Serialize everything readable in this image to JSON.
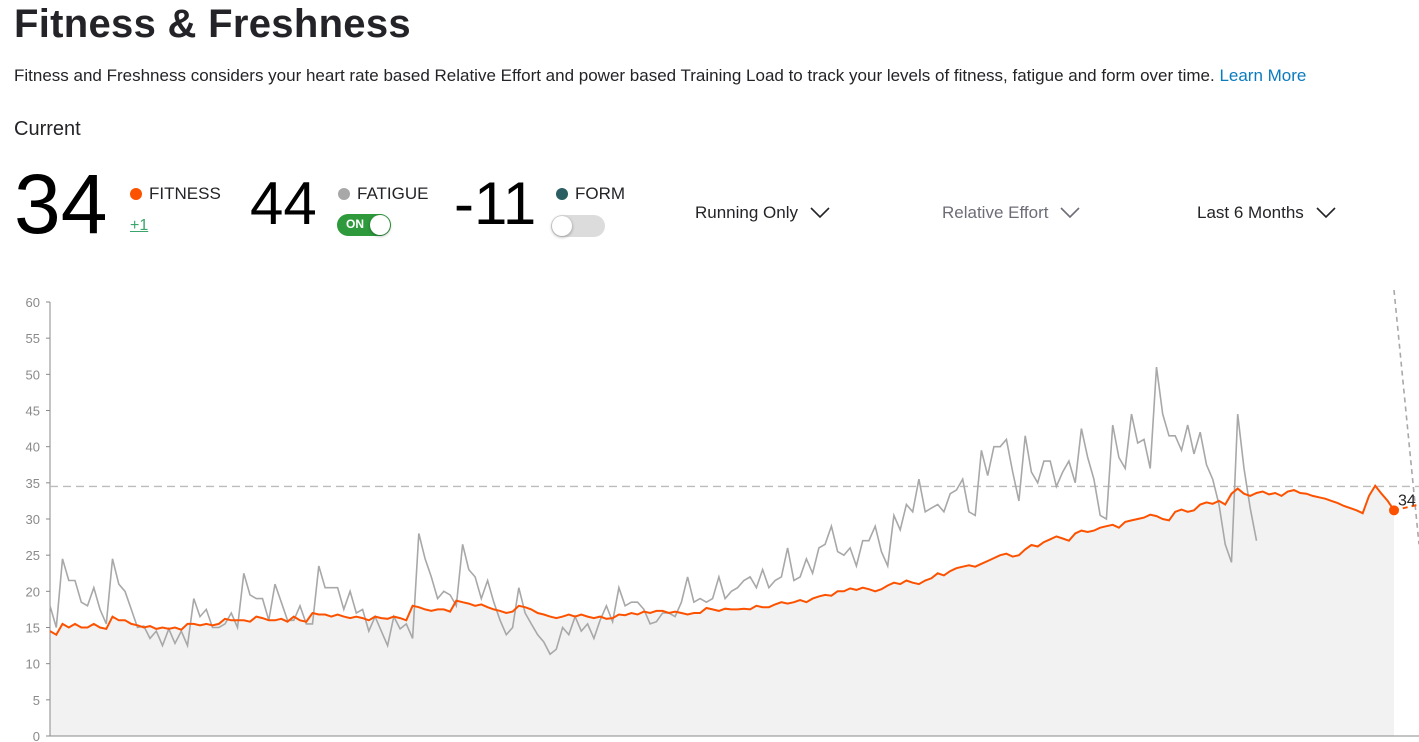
{
  "header": {
    "title": "Fitness & Freshness",
    "description": "Fitness and Freshness considers your heart rate based Relative Effort and power based Training Load to track your levels of fitness, fatigue and form over time.",
    "learn_more": "Learn More"
  },
  "current": {
    "label": "Current",
    "fitness": {
      "value": "34",
      "label": "FITNESS",
      "change": "+1",
      "color": "#fc5200"
    },
    "fatigue": {
      "value": "44",
      "label": "FATIGUE",
      "toggle_text": "ON",
      "toggle_on": true,
      "color": "#9e9e9e"
    },
    "form": {
      "value": "-11",
      "label": "FORM",
      "toggle_on": false,
      "color": "#2b5e63"
    }
  },
  "filters": {
    "activity": "Running Only",
    "metric": "Relative Effort",
    "range": "Last 6 Months"
  },
  "chart_data": {
    "type": "line",
    "title": "",
    "xlabel": "",
    "ylabel": "",
    "ylim": [
      0,
      60
    ],
    "yticks": [
      0,
      5,
      10,
      15,
      20,
      25,
      30,
      35,
      40,
      45,
      50,
      55,
      60
    ],
    "reference_line": 34.5,
    "end_label": "34",
    "series": [
      {
        "name": "FITNESS",
        "color": "#fc5200",
        "values": [
          14.5,
          14,
          15.5,
          15,
          15.5,
          15,
          15,
          15.5,
          15,
          14.8,
          16.5,
          16,
          16,
          15.5,
          15.3,
          15,
          15.2,
          14.8,
          15,
          14.8,
          15,
          14.7,
          15.5,
          15.5,
          15.3,
          15.5,
          15.3,
          15.5,
          16.2,
          16,
          16,
          16,
          15.8,
          16.5,
          16.3,
          16,
          16,
          16.2,
          15.8,
          16.5,
          16,
          15.8,
          17,
          16.8,
          16.8,
          16.5,
          16.8,
          16.5,
          16.3,
          16.5,
          16.3,
          16,
          16.5,
          16.3,
          16.2,
          16.5,
          16.3,
          16,
          18,
          17.8,
          17.5,
          17.3,
          17.5,
          17.5,
          17.2,
          18.7,
          18.5,
          18.3,
          18,
          18.2,
          17.8,
          17.5,
          17.3,
          17,
          17.2,
          18,
          17.8,
          17.5,
          17,
          16.8,
          16.5,
          16.3,
          16.5,
          16.8,
          16.5,
          16.8,
          16.5,
          16.3,
          16.5,
          16.2,
          16.3,
          16.8,
          16.7,
          17,
          16.8,
          17.2,
          17,
          17.3,
          17.3,
          17,
          17.2,
          17,
          16.8,
          17,
          17,
          17.7,
          17.5,
          17.3,
          17.6,
          17.5,
          17.5,
          17.6,
          17.5,
          18,
          17.8,
          17.8,
          18.2,
          18.5,
          18.3,
          18.5,
          18.8,
          18.5,
          19,
          19.3,
          19.5,
          19.4,
          20,
          20,
          20.4,
          20.2,
          20.5,
          20.3,
          20,
          20.3,
          20.8,
          21.2,
          21,
          21.5,
          21.2,
          21,
          21.5,
          21.8,
          22.5,
          22.2,
          22.8,
          23.2,
          23.4,
          23.6,
          23.4,
          23.8,
          24.2,
          24.6,
          25,
          25.2,
          24.8,
          25,
          25.8,
          26.4,
          26.2,
          26.8,
          27.2,
          27.6,
          27.3,
          27,
          28,
          28.4,
          28.2,
          28.4,
          28.8,
          29,
          29.2,
          28.8,
          29.6,
          29.8,
          30,
          30.2,
          30.6,
          30.4,
          30,
          29.8,
          31,
          31.3,
          31,
          31.2,
          32,
          32.3,
          32.1,
          32.5,
          32,
          33.5,
          34.2,
          33.5,
          33.2,
          33.6,
          33.8,
          33.4,
          33.6,
          33.2,
          33.8,
          34,
          33.6,
          33.5,
          33.2,
          33,
          32.8,
          32.5,
          32.2,
          31.8,
          31.5,
          31.2,
          30.8,
          33.2,
          34.6,
          33.5,
          32.5,
          31.2
        ]
      },
      {
        "name": "FATIGUE",
        "color": "#a8a8a8",
        "values": [
          18,
          15,
          24.5,
          21.5,
          21.5,
          18.5,
          18,
          20.5,
          17.5,
          15.5,
          24.5,
          21,
          20,
          17.5,
          15,
          15.2,
          13.5,
          14.5,
          12.5,
          14.8,
          12.8,
          14.5,
          12.5,
          19,
          16.5,
          17.5,
          15,
          15,
          15.5,
          17,
          15,
          22.5,
          19.5,
          19,
          19,
          16,
          21,
          18.5,
          16,
          16,
          18,
          15.5,
          15.5,
          23.5,
          20.5,
          20.5,
          20.5,
          17.5,
          20,
          17,
          17.5,
          14.5,
          16.5,
          14.5,
          12.5,
          16.5,
          14.8,
          15.5,
          13.5,
          28,
          24.5,
          22,
          19,
          20,
          19.5,
          18,
          26.5,
          23,
          22,
          19,
          21.5,
          18.5,
          16,
          14,
          15,
          20.5,
          17,
          15.5,
          14,
          13,
          11.3,
          12,
          15,
          14,
          16.5,
          14.5,
          15.5,
          13.5,
          16,
          18,
          15.8,
          20.5,
          18,
          18.5,
          18.5,
          17.5,
          15.5,
          15.8,
          17,
          17,
          16.5,
          18.5,
          22,
          18.5,
          19,
          18.5,
          19,
          22,
          19,
          20,
          20.5,
          21.5,
          22,
          20.5,
          23,
          20.5,
          21.5,
          22,
          26,
          21.5,
          22,
          24.5,
          22.5,
          26,
          26.5,
          29,
          25.5,
          25,
          26,
          23.5,
          27,
          27,
          29,
          25.5,
          23.5,
          30.5,
          28.5,
          32,
          31,
          35.5,
          31,
          31.5,
          32,
          31,
          33.5,
          34,
          35.5,
          31,
          30.5,
          39.5,
          36,
          40,
          40,
          41,
          36.5,
          32.5,
          41.5,
          36.5,
          35,
          38,
          38,
          34.5,
          36.5,
          38,
          35,
          42.5,
          38.5,
          35.5,
          30.5,
          30,
          43,
          38.5,
          37,
          44.5,
          40.5,
          41,
          37,
          51,
          44.5,
          41.5,
          41.5,
          39.5,
          43,
          39,
          42,
          37.5,
          35.5,
          32,
          26.5,
          24,
          44.5,
          37,
          31.5,
          27
        ]
      }
    ]
  }
}
